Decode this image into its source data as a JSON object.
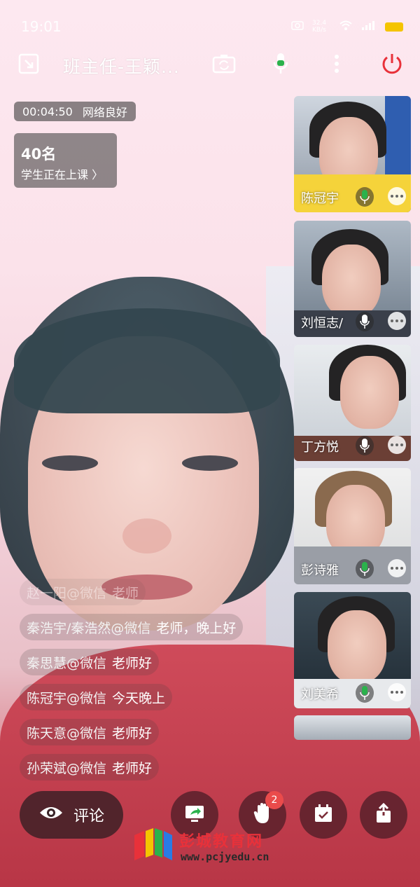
{
  "status_bar": {
    "time": "19:01",
    "net_speed": "32.4 KB/s"
  },
  "top_bar": {
    "title": "班主任-王颖..."
  },
  "session": {
    "duration": "00:04:50",
    "network": "网络良好"
  },
  "students": {
    "count": "40名",
    "label": "学生正在上课 〉"
  },
  "participants": [
    {
      "name": "陈冠宇",
      "mic": "on"
    },
    {
      "name": "刘恒志/",
      "mic": "off"
    },
    {
      "name": "丁方悦",
      "mic": "off"
    },
    {
      "name": "彭诗雅",
      "mic": "on"
    },
    {
      "name": "刘美希",
      "mic": "on"
    }
  ],
  "chat": [
    {
      "user": "赵一阳@微信",
      "text": "老师"
    },
    {
      "user": "秦浩宇/秦浩然@微信",
      "text": "老师，晚上好"
    },
    {
      "user": "秦思慧@微信",
      "text": "老师好"
    },
    {
      "user": "陈冠宇@微信",
      "text": "今天晚上"
    },
    {
      "user": "陈天意@微信",
      "text": "老师好"
    },
    {
      "user": "孙荣斌@微信",
      "text": "老师好"
    }
  ],
  "toolbar": {
    "comment_label": "评论",
    "raise_hand_badge": "2"
  },
  "watermark": {
    "title": "彭城教育网",
    "url": "www.pcjyedu.cn"
  },
  "colors": {
    "accent_red": "#e8313a",
    "mic_green": "#2bb24c",
    "battery": "#f4c400"
  }
}
